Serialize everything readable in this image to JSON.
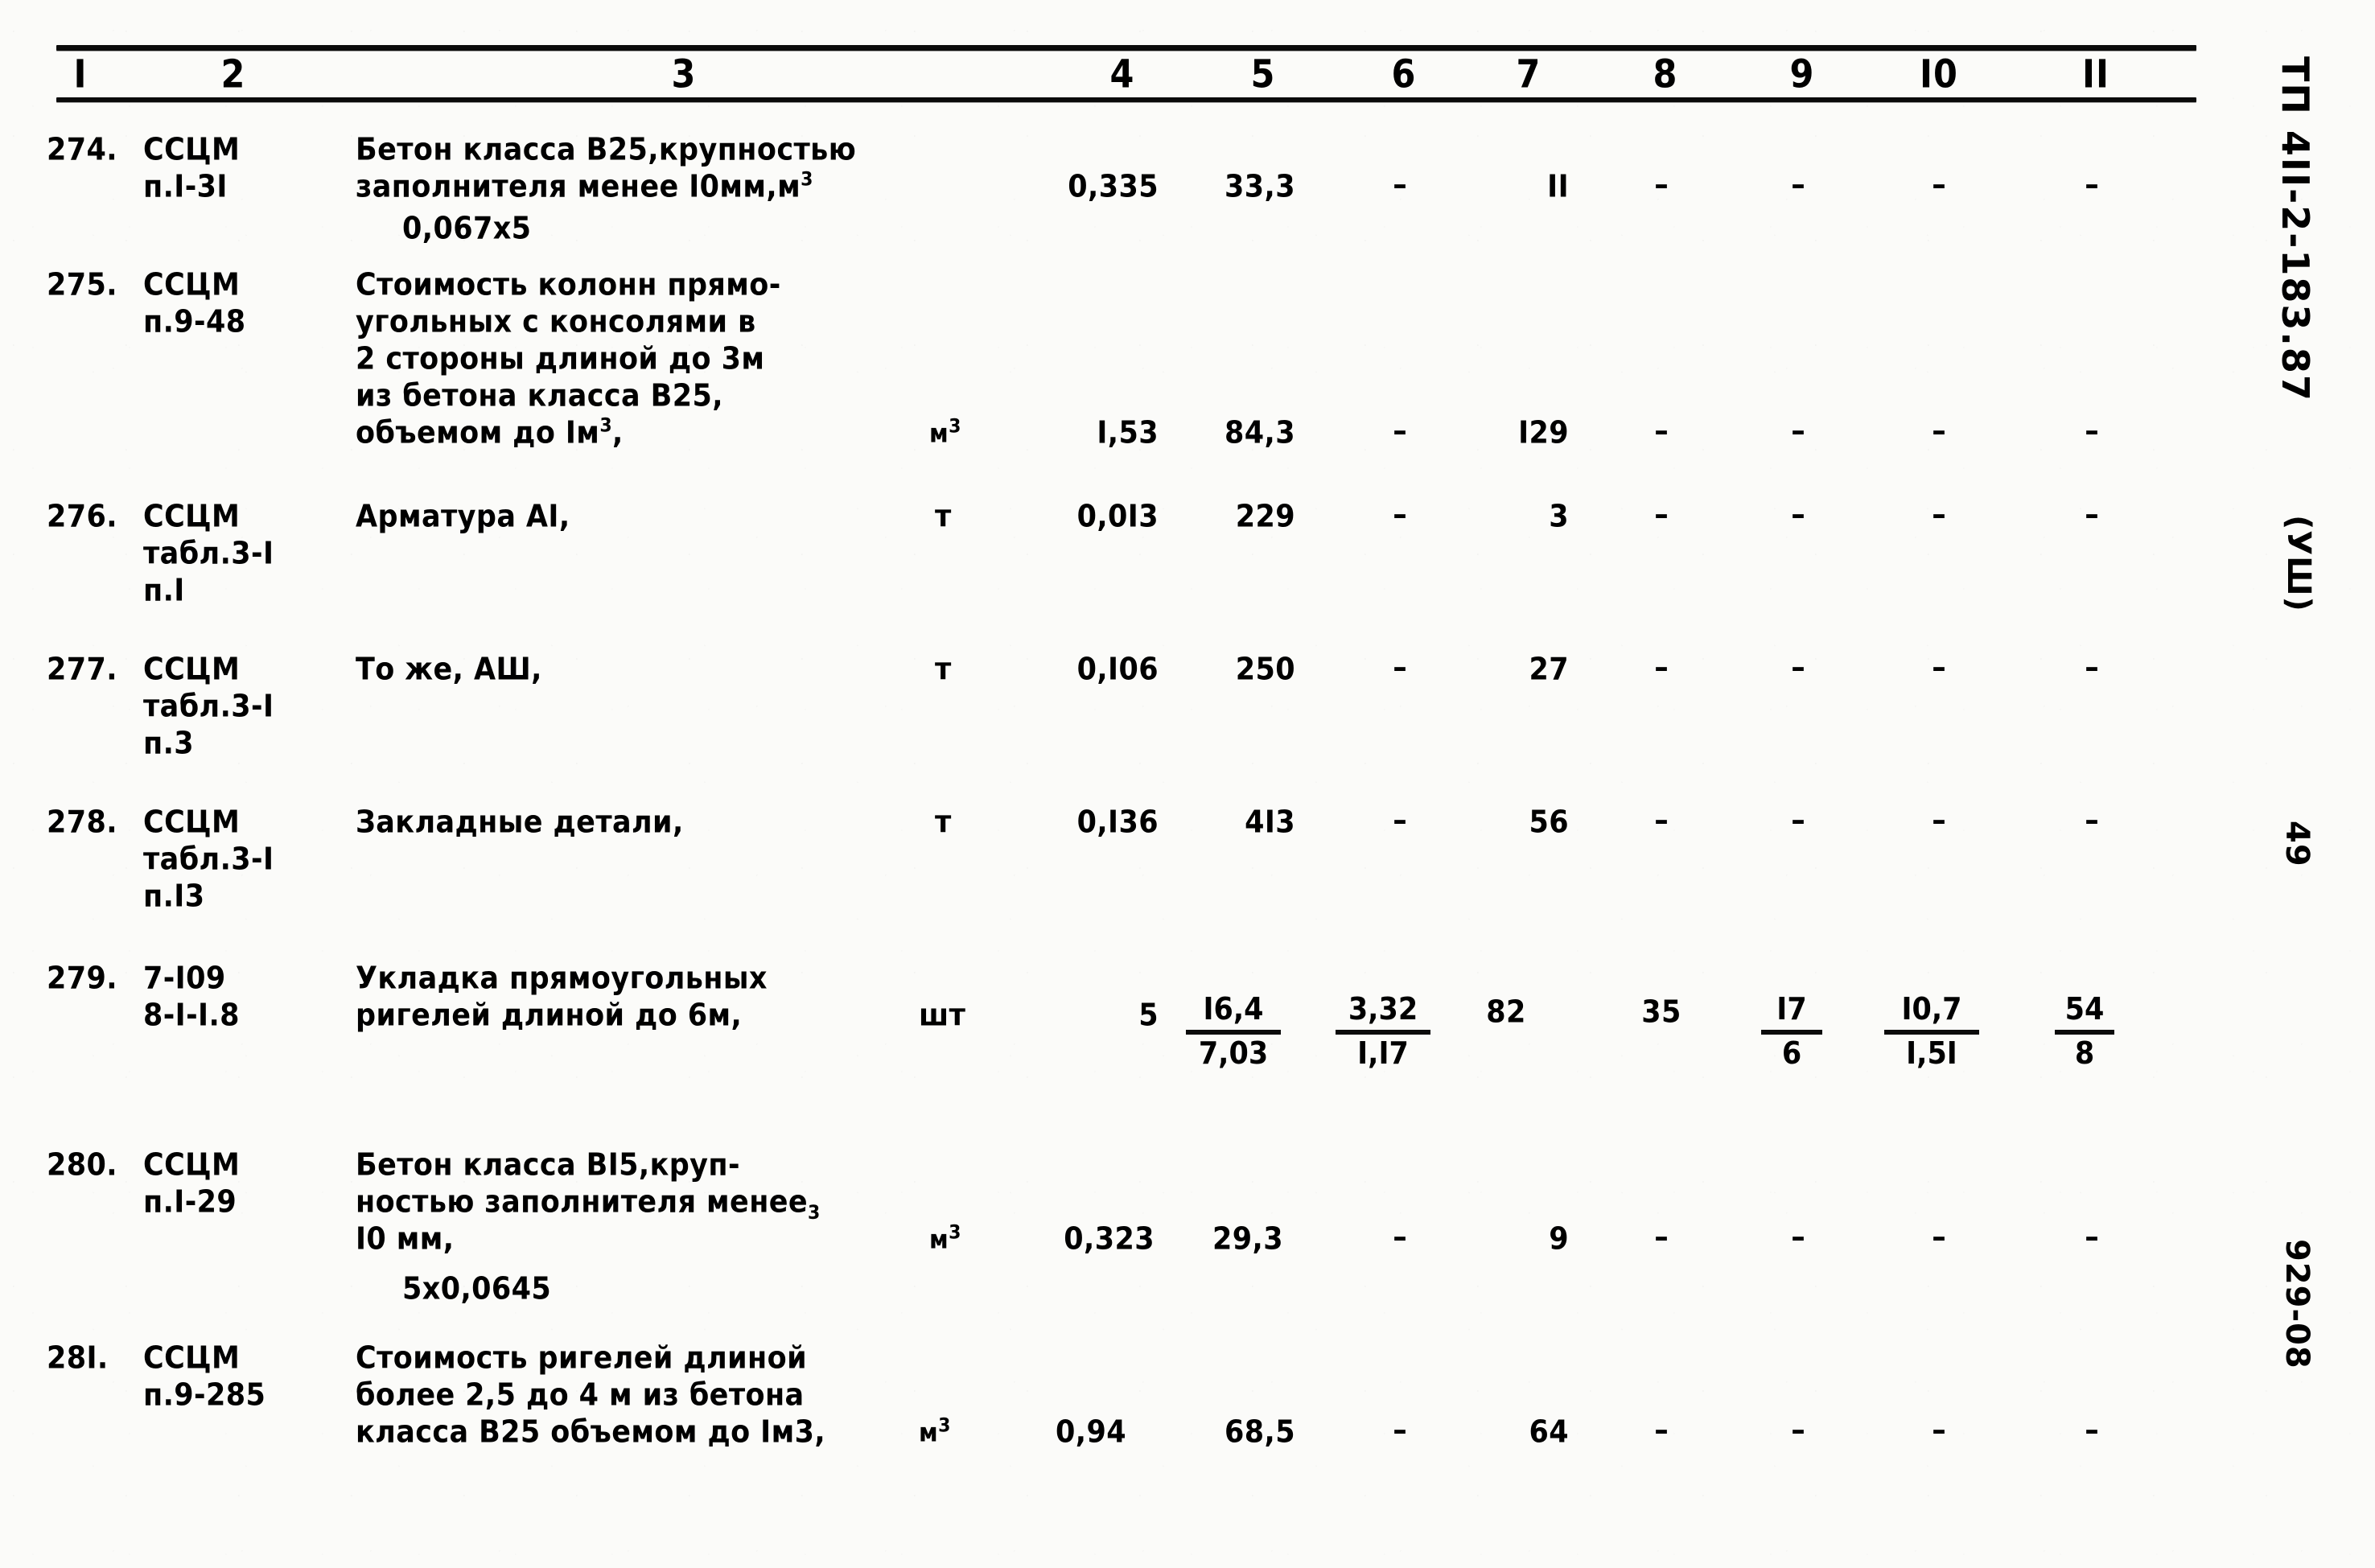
{
  "document": {
    "type": "construction-cost-estimate-table",
    "column_headers": [
      "I",
      "2",
      "3",
      "4",
      "5",
      "6",
      "7",
      "8",
      "9",
      "I0",
      "II"
    ],
    "margin_stamps": {
      "code": "ТП 4II-2-183.87",
      "variant": "(УШ)",
      "page": "49",
      "series": "929-08"
    }
  },
  "rows": [
    {
      "no": "274.",
      "code_lines": [
        "ССЦМ",
        "п.I-3I"
      ],
      "desc_lines": [
        "Бетон класса В25,крупностью",
        "заполнителя менее I0мм,м"
      ],
      "desc_sup": "3",
      "desc_extra": "0,067x5",
      "unit": "",
      "c4": "0,335",
      "c5": "33,3",
      "c6": "–",
      "c7": "II",
      "c8": "–",
      "c9": "–",
      "c10": "–",
      "c11": "–"
    },
    {
      "no": "275.",
      "code_lines": [
        "ССЦМ",
        "п.9-48"
      ],
      "desc_lines": [
        "Стоимость колонн прямо-",
        "угольных с консолями в",
        "2 стороны длиной до 3м",
        "из бетона класса В25,",
        "объемом до Iм"
      ],
      "desc_sup": "3",
      "desc_tail": ",",
      "desc_extra": "",
      "unit": "м",
      "unit_sup": "3",
      "c4": "I,53",
      "c5": "84,3",
      "c6": "–",
      "c7": "I29",
      "c8": "–",
      "c9": "–",
      "c10": "–",
      "c11": "–"
    },
    {
      "no": "276.",
      "code_lines": [
        "ССЦМ",
        "табл.3-I",
        "п.I"
      ],
      "desc_lines": [
        "Арматура АI,"
      ],
      "unit": "т",
      "c4": "0,0I3",
      "c5": "229",
      "c6": "–",
      "c7": "3",
      "c8": "–",
      "c9": "–",
      "c10": "–",
      "c11": "–"
    },
    {
      "no": "277.",
      "code_lines": [
        "ССЦМ",
        "табл.3-I",
        "п.3"
      ],
      "desc_lines": [
        "То же, АШ,"
      ],
      "unit": "т",
      "c4": "0,I06",
      "c5": "250",
      "c6": "–",
      "c7": "27",
      "c8": "–",
      "c9": "–",
      "c10": "–",
      "c11": "–"
    },
    {
      "no": "278.",
      "code_lines": [
        "ССЦМ",
        "табл.3-I",
        "п.I3"
      ],
      "desc_lines": [
        "Закладные детали,"
      ],
      "unit": "т",
      "c4": "0,I36",
      "c5": "4I3",
      "c6": "–",
      "c7": "56",
      "c8": "–",
      "c9": "–",
      "c10": "–",
      "c11": "–"
    },
    {
      "no": "279.",
      "code_lines": [
        "7-I09",
        "8-I-I.8"
      ],
      "desc_lines": [
        "Укладка прямоугольных",
        "ригелей длиной до 6м,"
      ],
      "unit": "шт",
      "c4": "5",
      "c5_top": "I6,4",
      "c5_bot": "7,03",
      "c6_top": "3,32",
      "c6_bot": "I,I7",
      "c7": "82",
      "c8": "35",
      "c9_top": "I7",
      "c9_bot": "6",
      "c10_top": "I0,7",
      "c10_bot": "I,5I",
      "c11_top": "54",
      "c11_bot": "8"
    },
    {
      "no": "280.",
      "code_lines": [
        "ССЦМ",
        "п.I-29"
      ],
      "desc_lines": [
        "Бетон класса ВI5,круп-",
        "ностью заполнителя менее",
        "I0 мм,"
      ],
      "desc_sup_after_line2": "3",
      "desc_extra": "5х0,0645",
      "unit": "м",
      "unit_sup": "3",
      "c4": "0,323",
      "c5": "29,3",
      "c6": "–",
      "c7": "9",
      "c8": "–",
      "c9": "–",
      "c10": "–",
      "c11": "–"
    },
    {
      "no": "28I.",
      "code_lines": [
        "ССЦМ",
        "п.9-285"
      ],
      "desc_lines": [
        "Стоимость ригелей длиной",
        "более 2,5 до 4 м из бетона",
        "класса В25 объемом до Iм3,"
      ],
      "unit": "м",
      "unit_sup": "3",
      "c4": "0,94",
      "c5": "68,5",
      "c6": "–",
      "c7": "64",
      "c8": "–",
      "c9": "–",
      "c10": "–",
      "c11": "–"
    }
  ]
}
